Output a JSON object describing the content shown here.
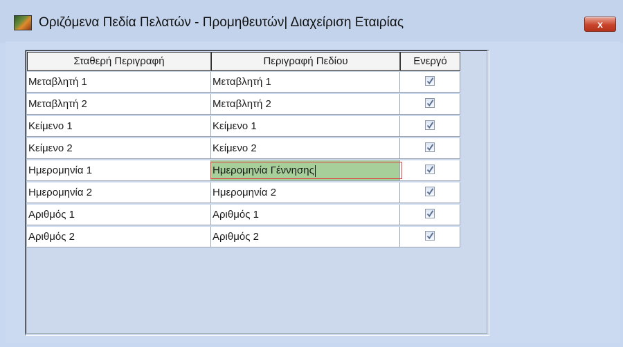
{
  "window": {
    "title": "Οριζόμενα Πεδία Πελατών - Προμηθευτών| Διαχείριση Εταιρίας",
    "close_label": "x"
  },
  "grid": {
    "columns": [
      "Σταθερή Περιγραφή",
      "Περιγραφή Πεδίου",
      "Ενεργό"
    ],
    "rows": [
      {
        "fixed": "Μεταβλητή 1",
        "desc": "Μεταβλητή 1",
        "active": true
      },
      {
        "fixed": "Μεταβλητή 2",
        "desc": "Μεταβλητή 2",
        "active": true
      },
      {
        "fixed": "Κείμενο 1",
        "desc": "Κείμενο 1",
        "active": true
      },
      {
        "fixed": "Κείμενο 2",
        "desc": "Κείμενο 2",
        "active": true
      },
      {
        "fixed": "Ημερομηνία 1",
        "desc": "Ημερομηνία Γέννησης",
        "active": true,
        "editing": true
      },
      {
        "fixed": "Ημερομηνία 2",
        "desc": "Ημερομηνία 2",
        "active": true
      },
      {
        "fixed": "Αριθμός 1",
        "desc": "Αριθμός 1",
        "active": true
      },
      {
        "fixed": "Αριθμός 2",
        "desc": "Αριθμός 2",
        "active": true
      }
    ]
  },
  "colors": {
    "window_bg": "#c8d8f0",
    "edit_cell": "#a7cf9a",
    "edit_outline": "#e04040",
    "checkmark": "#5a6f93"
  }
}
